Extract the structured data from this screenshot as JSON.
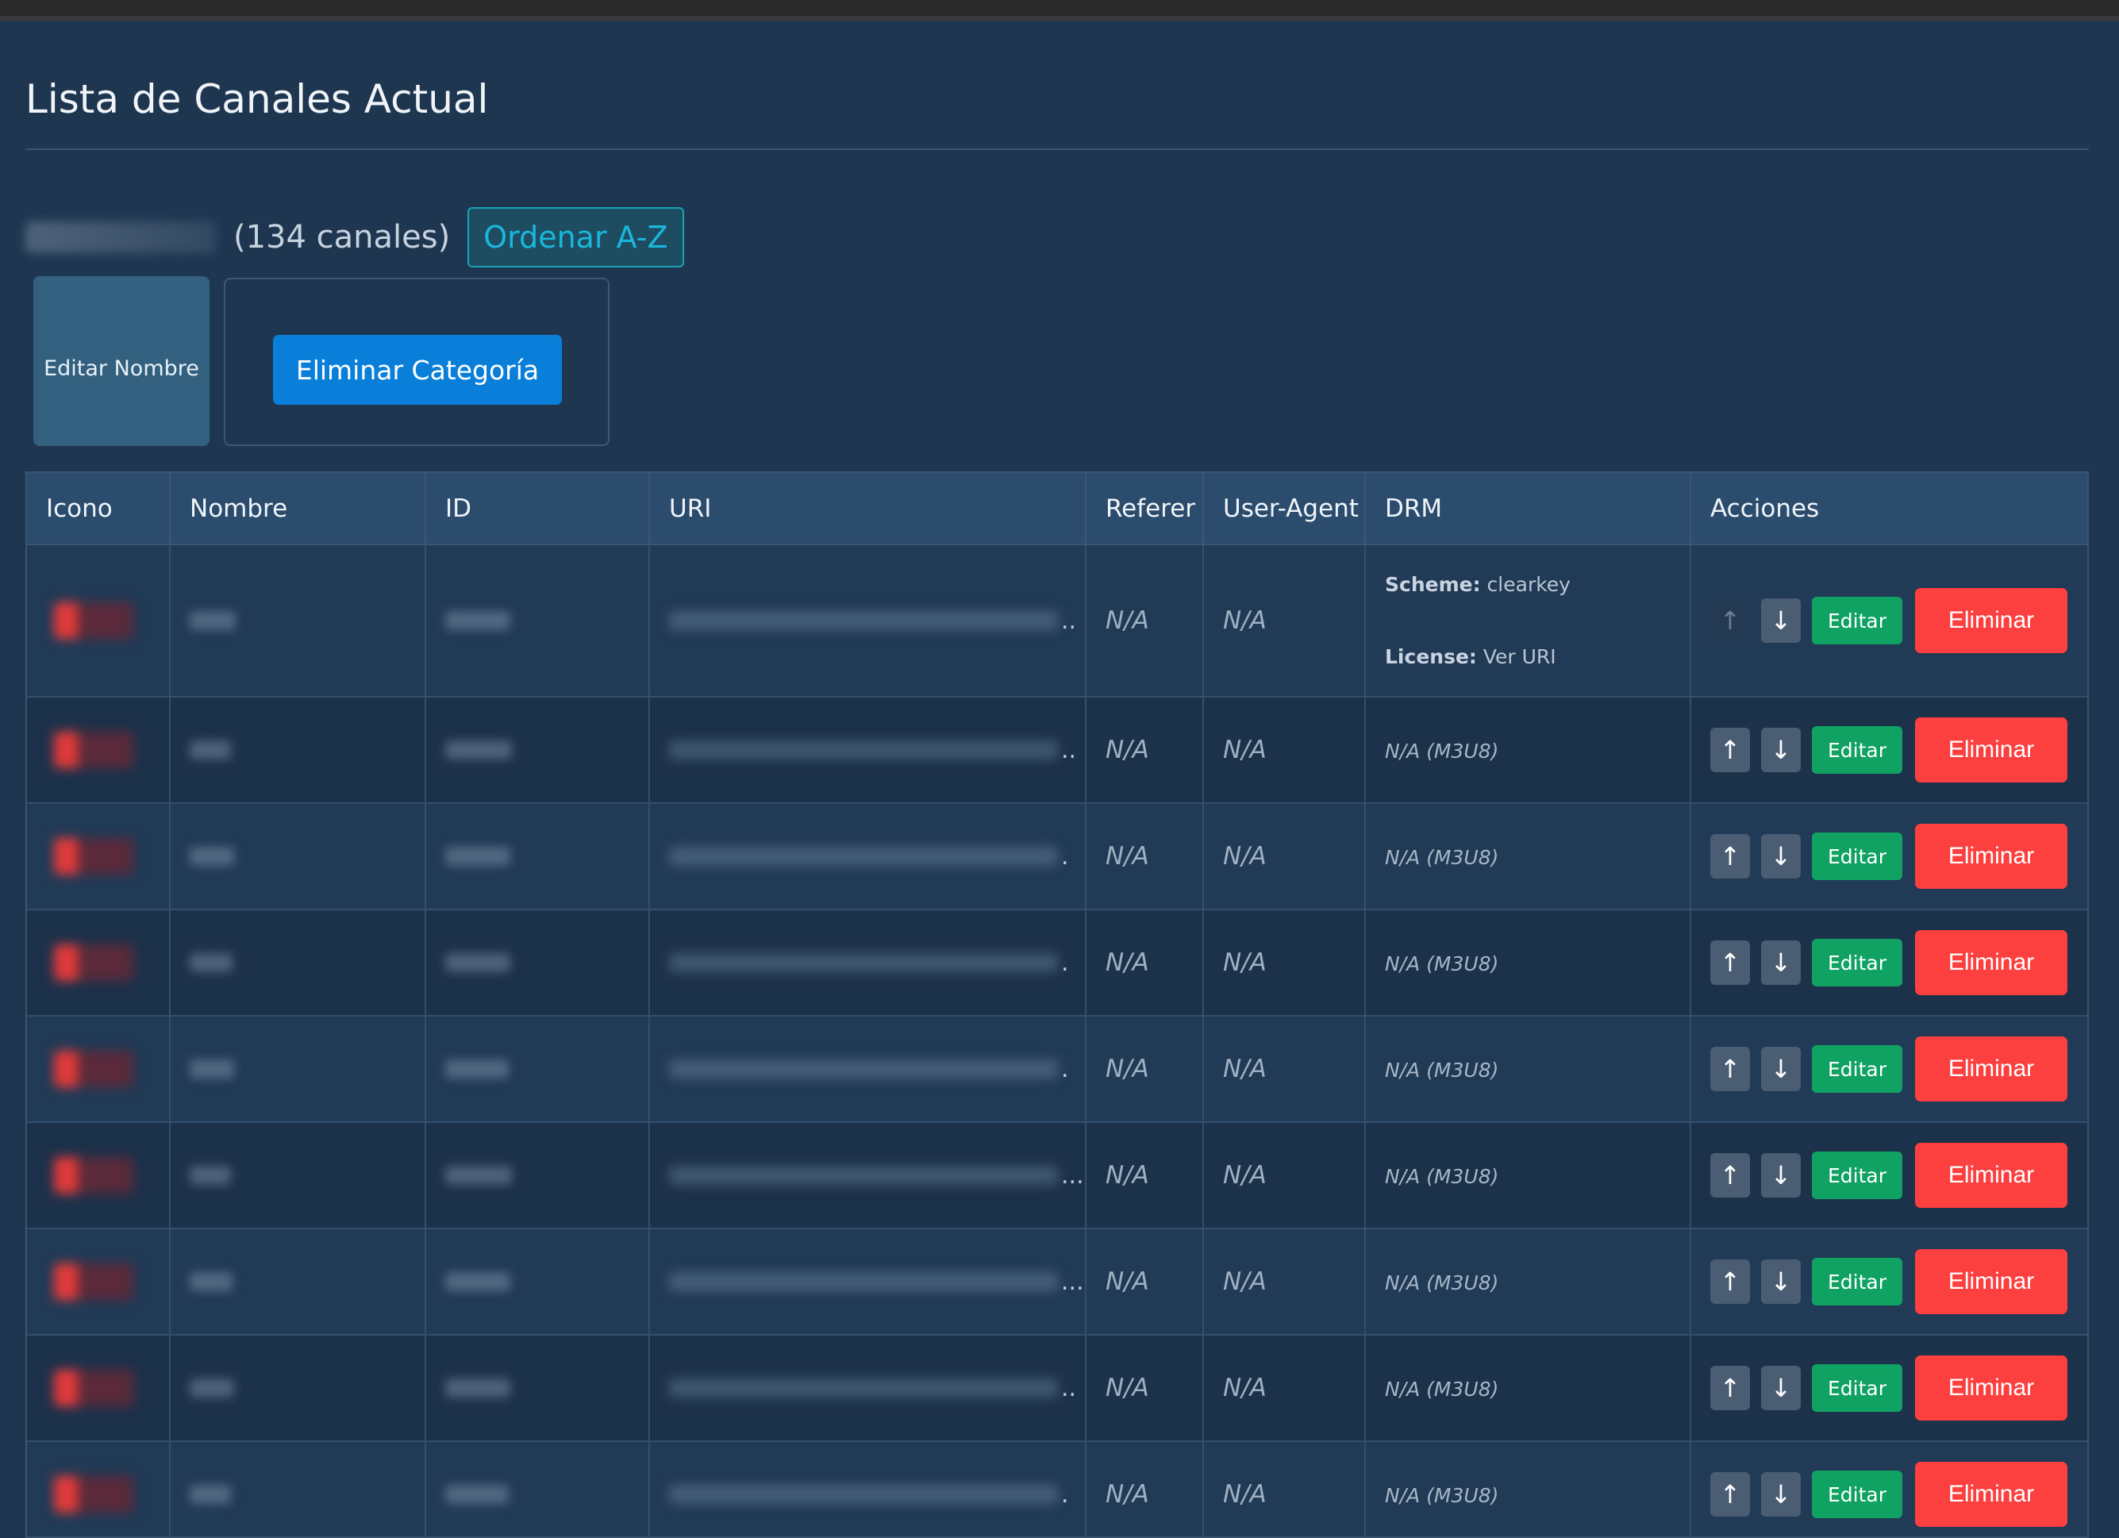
{
  "page_title": "Lista de Canales Actual",
  "category": {
    "count_text": "(134 canales)",
    "sort_label": "Ordenar A-Z",
    "edit_name_label": "Editar Nombre",
    "delete_label": "Eliminar Categoría"
  },
  "table": {
    "headers": [
      "Icono",
      "Nombre",
      "ID",
      "URI",
      "Referer",
      "User-Agent",
      "DRM",
      "Acciones"
    ],
    "rows": [
      {
        "referer": "N/A",
        "user_agent": "N/A",
        "drm_scheme_label": "Scheme:",
        "drm_scheme": "clearkey",
        "drm_license_label": "License:",
        "drm_license": "Ver URI",
        "edit": "Editar",
        "delete": "Eliminar",
        "ellipsis": ".."
      },
      {
        "referer": "N/A",
        "user_agent": "N/A",
        "drm": "N/A (M3U8)",
        "edit": "Editar",
        "delete": "Eliminar",
        "ellipsis": ".."
      },
      {
        "referer": "N/A",
        "user_agent": "N/A",
        "drm": "N/A (M3U8)",
        "edit": "Editar",
        "delete": "Eliminar",
        "ellipsis": "."
      },
      {
        "referer": "N/A",
        "user_agent": "N/A",
        "drm": "N/A (M3U8)",
        "edit": "Editar",
        "delete": "Eliminar",
        "ellipsis": "."
      },
      {
        "referer": "N/A",
        "user_agent": "N/A",
        "drm": "N/A (M3U8)",
        "edit": "Editar",
        "delete": "Eliminar",
        "ellipsis": "."
      },
      {
        "referer": "N/A",
        "user_agent": "N/A",
        "drm": "N/A (M3U8)",
        "edit": "Editar",
        "delete": "Eliminar",
        "ellipsis": "..."
      },
      {
        "referer": "N/A",
        "user_agent": "N/A",
        "drm": "N/A (M3U8)",
        "edit": "Editar",
        "delete": "Eliminar",
        "ellipsis": "..."
      },
      {
        "referer": "N/A",
        "user_agent": "N/A",
        "drm": "N/A (M3U8)",
        "edit": "Editar",
        "delete": "Eliminar",
        "ellipsis": ".."
      },
      {
        "referer": "N/A",
        "user_agent": "N/A",
        "drm": "N/A (M3U8)",
        "edit": "Editar",
        "delete": "Eliminar",
        "ellipsis": "."
      }
    ]
  },
  "icons": {
    "move_up": "↑",
    "move_down": "↓"
  },
  "colors": {
    "background": "#1f3651",
    "edit_button": "#0fa263",
    "delete_button": "#fc3f3f",
    "primary_button": "#0a7fd9",
    "sort_button": "#17a2b8"
  }
}
